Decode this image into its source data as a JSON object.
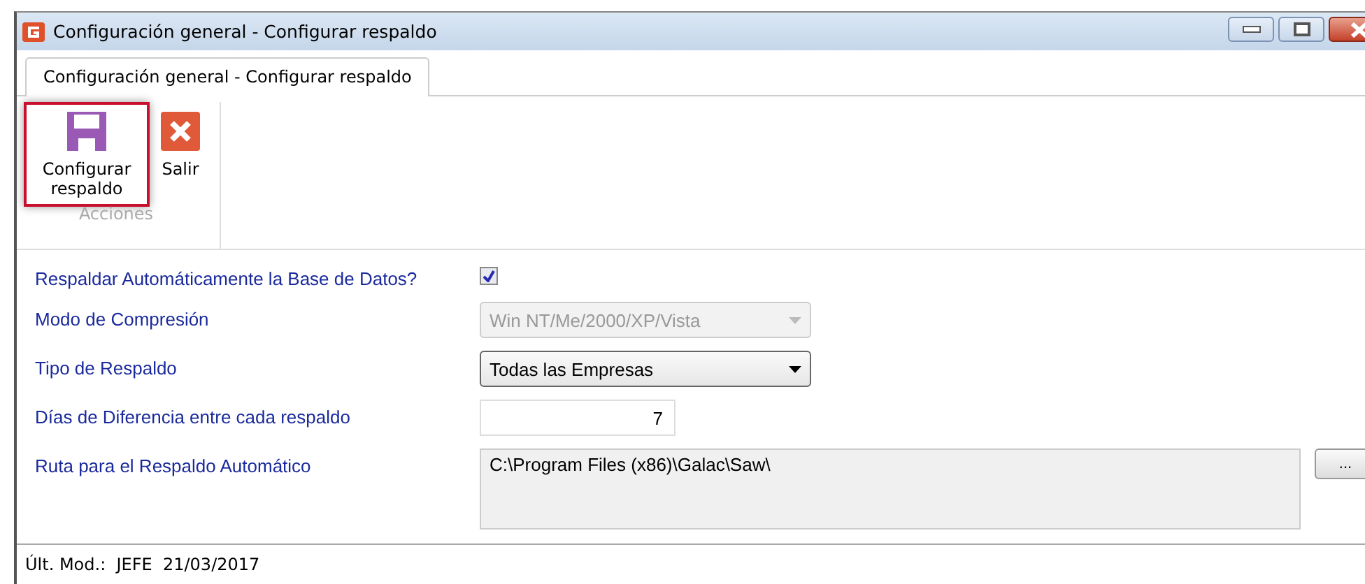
{
  "window": {
    "title": "Configuración general - Configurar respaldo",
    "controls": [
      {
        "kind": "minimize"
      },
      {
        "kind": "maximize"
      },
      {
        "kind": "close"
      }
    ]
  },
  "tabs": [
    {
      "label": "Configuración general - Configurar respaldo",
      "selected": true
    }
  ],
  "ribbon": {
    "group": "Acciones",
    "buttons": [
      {
        "kind": "save",
        "label": "Configurar respaldo",
        "selected": true
      },
      {
        "kind": "exit",
        "label": "Salir",
        "selected": false
      }
    ]
  },
  "form": [
    {
      "kind": "checkbox",
      "label": "Respaldar Automáticamente la Base de Datos?",
      "checked": true
    },
    {
      "kind": "combo",
      "label": "Modo de Compresión",
      "value": "Win NT/Me/2000/XP/Vista",
      "disabled": true
    },
    {
      "kind": "combo",
      "label": "Tipo de Respaldo",
      "value": "Todas las Empresas",
      "disabled": false
    },
    {
      "kind": "number",
      "label": "Días de Diferencia entre cada respaldo",
      "value": "7"
    },
    {
      "kind": "path",
      "label": "Ruta para el Respaldo Automático",
      "value": "C:\\Program Files (x86)\\Galac\\Saw\\",
      "button": "..."
    }
  ],
  "status_bar": {
    "text": "Últ. Mod.:  JEFE  21/03/2017"
  }
}
